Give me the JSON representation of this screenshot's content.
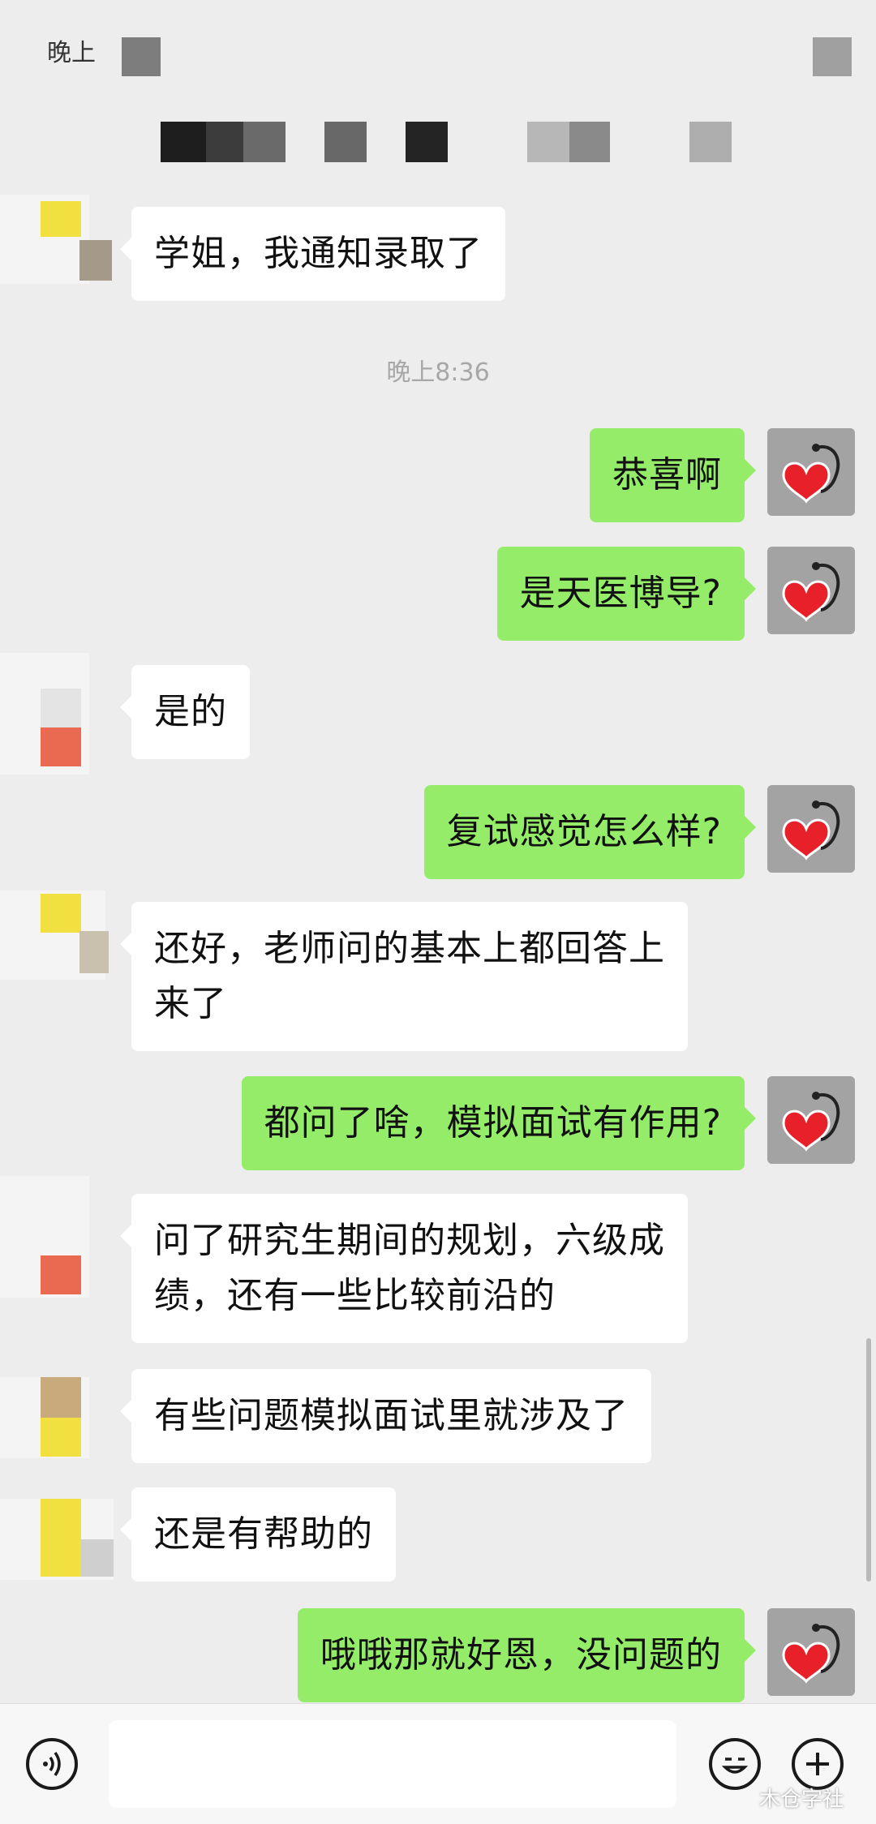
{
  "status_bar": {
    "time_label": "晚上"
  },
  "chat": {
    "timestamp": "晚上8:36",
    "messages": [
      {
        "side": "in",
        "text": "学姐，我通知录取了"
      },
      {
        "side": "out",
        "text": "恭喜啊"
      },
      {
        "side": "out",
        "text": "是天医博导?"
      },
      {
        "side": "in",
        "text": "是的"
      },
      {
        "side": "out",
        "text": "复试感觉怎么样?"
      },
      {
        "side": "in",
        "line1": "还好，老师问的基本上都回答上",
        "line2": "来了"
      },
      {
        "side": "out",
        "text": "都问了啥，模拟面试有作用?"
      },
      {
        "side": "in",
        "line1": "问了研究生期间的规划，六级成",
        "line2": "绩，还有一些比较前沿的"
      },
      {
        "side": "in",
        "text": "有些问题模拟面试里就涉及了"
      },
      {
        "side": "in",
        "text": "还是有帮助的"
      },
      {
        "side": "out",
        "text": "哦哦那就好恩，没问题的"
      }
    ]
  },
  "input_bar": {
    "voice_icon": "voice-icon",
    "emoji_icon": "emoji-icon",
    "plus_icon": "plus-icon"
  },
  "watermark": "木仓字社",
  "colors": {
    "background": "#ededed",
    "incoming_bubble": "#ffffff",
    "outgoing_bubble": "#95ec69",
    "timestamp": "#a7a7a7"
  }
}
